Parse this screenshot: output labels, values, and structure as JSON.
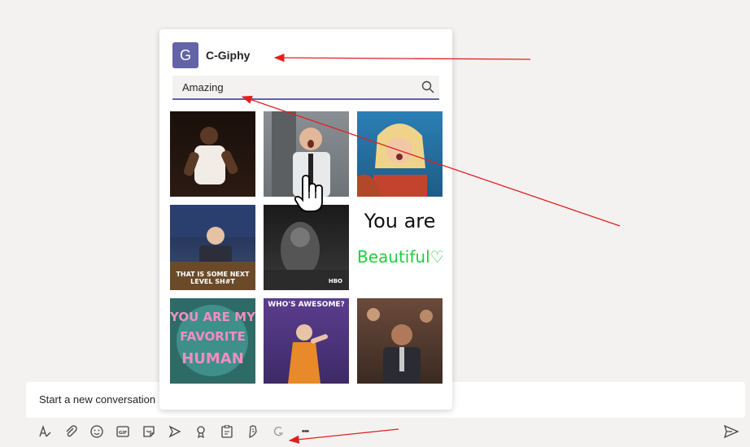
{
  "compose": {
    "placeholder": "Start a new conversation"
  },
  "toolbar": {
    "icons": [
      "format-icon",
      "attach-icon",
      "emoji-icon",
      "gif-icon",
      "sticker-icon",
      "meet-now-icon",
      "praise-icon",
      "forms-icon",
      "stream-icon",
      "giphy-app-icon",
      "more-options-icon"
    ],
    "gif_label": "GIF",
    "more_label": "•••"
  },
  "popover": {
    "app_initial": "G",
    "app_name": "C-Giphy",
    "search_value": "Amazing"
  },
  "gifs": [
    {
      "name": "gif-dancing-man",
      "caption": ""
    },
    {
      "name": "gif-surprised-man",
      "caption": ""
    },
    {
      "name": "gif-shocked-woman",
      "caption": ""
    },
    {
      "name": "gif-talk-show-host",
      "caption": "THAT IS SOME NEXT LEVEL SH#T"
    },
    {
      "name": "gif-dark-scene",
      "caption": "HBO"
    },
    {
      "name": "gif-you-are-beautiful",
      "line1": "You are",
      "line2": "Beautiful♡"
    },
    {
      "name": "gif-favorite-human",
      "line1": "YOU ARE MY",
      "line2": "FAVORITE",
      "line3": "HUMAN"
    },
    {
      "name": "gif-whos-awesome",
      "caption": "WHO'S AWESOME?"
    },
    {
      "name": "gif-crowd-clapping",
      "caption": ""
    }
  ],
  "colors": {
    "accent": "#6264a7",
    "annotation": "#e02020"
  }
}
